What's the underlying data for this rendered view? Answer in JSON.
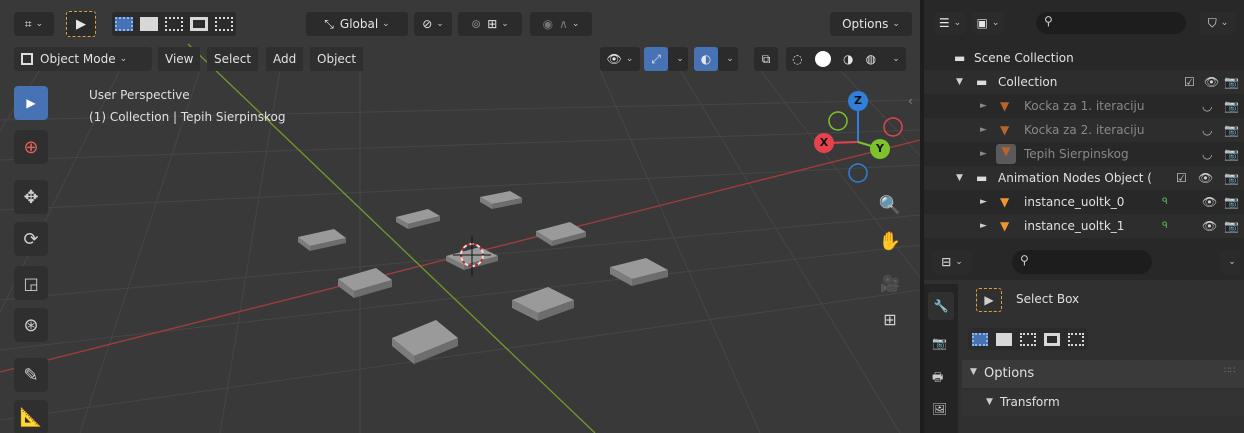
{
  "header": {
    "transform_orientation": "Global",
    "options_label": "Options"
  },
  "header2": {
    "mode": "Object Mode",
    "menus": [
      "View",
      "Select",
      "Add",
      "Object"
    ]
  },
  "viewport": {
    "perspective_label": "User Perspective",
    "collection_label": "(1) Collection | Tepih Sierpinskog",
    "gizmo_axes": {
      "z": "Z",
      "x": "X",
      "y": "Y"
    },
    "colors": {
      "accent": "#4772b3",
      "x_axis": "#e5424d",
      "y_axis": "#7ec22b",
      "z_axis": "#2f7fdb",
      "grid": "#454545"
    }
  },
  "outliner": {
    "root": "Scene Collection",
    "items": [
      {
        "name": "Collection"
      },
      {
        "name": "Kocka za 1. iteraciju"
      },
      {
        "name": "Kocka za 2. iteraciju"
      },
      {
        "name": "Tepih Sierpinskog"
      },
      {
        "name": "Animation Nodes Object ("
      },
      {
        "name": "instance_uoltk_0"
      },
      {
        "name": "instance_uoltk_1"
      }
    ]
  },
  "properties": {
    "tool_name": "Select Box",
    "panel_options": "Options",
    "panel_transform": "Transform"
  }
}
